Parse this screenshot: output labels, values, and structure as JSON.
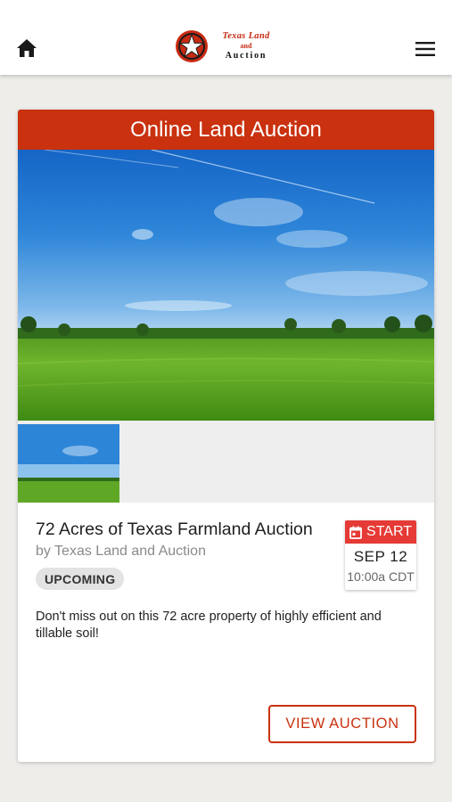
{
  "header": {
    "home_icon": "home-icon",
    "menu_icon": "hamburger-menu-icon",
    "logo": {
      "line1": "Texas Land",
      "line2": "and",
      "line3": "Auction",
      "colors": {
        "red": "#c62a12",
        "dark": "#111111"
      }
    }
  },
  "card": {
    "header_label": "Online Land Auction",
    "accent_color": "#c9310f",
    "title": "72 Acres of Texas Farmland Auction",
    "byline": "by Texas Land and Auction",
    "status_badge": "UPCOMING",
    "start": {
      "icon": "calendar-icon",
      "label": "START",
      "date": "SEP 12",
      "time": "10:00a CDT",
      "color": "#e53a35"
    },
    "description": "Don't miss out on this 72 acre property of highly efficient and tillable soil!",
    "cta_label": "VIEW AUCTION"
  }
}
